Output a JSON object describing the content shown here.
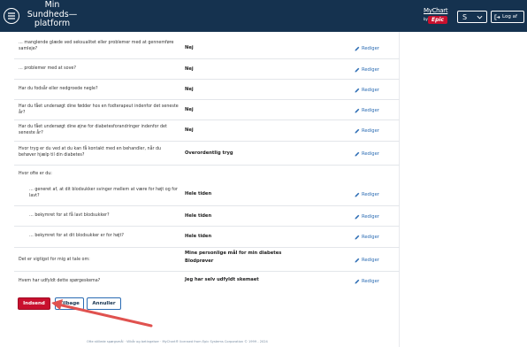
{
  "header": {
    "brand_line1": "Min",
    "brand_line2": "Sundheds—",
    "brand_line3": "platform",
    "mychart_label": "MyChart",
    "mychart_by": "by",
    "epic_label": "Epic",
    "user_initial": "S",
    "logout_label": "Log af"
  },
  "rows": [
    {
      "question": "… manglende glæde ved seksualitet eller problemer med at gennemføre samleje?",
      "answer": "Nej",
      "edit": "Rediger"
    },
    {
      "question": "… problemer med at sove?",
      "answer": "Nej",
      "edit": "Rediger"
    },
    {
      "question": "Har du fodsår eller nedgroede negle?",
      "answer": "Nej",
      "edit": "Rediger"
    },
    {
      "question": "Har du fået undersøgt dine fødder hos en fodterapeut indenfor det seneste år?",
      "answer": "Nej",
      "edit": "Rediger"
    },
    {
      "question": "Har du fået undersøgt dine øjne for diabetesforandringer indenfor det seneste år?",
      "answer": "Nej",
      "edit": "Rediger"
    },
    {
      "question": "Hvor tryg er du ved at du kan få kontakt med en behandler, når du behøver hjælp til din diabetes?",
      "answer": "Overordentlig tryg",
      "edit": "Rediger"
    },
    {
      "question": "Hvor ofte er du:",
      "answer": "",
      "edit": ""
    },
    {
      "question": "… generet af, at dit blodsukker svinger mellem at være for højt og for lavt?",
      "answer": "Hele tiden",
      "edit": "Rediger"
    },
    {
      "question": "… bekymret for at få lavt blodsukker?",
      "answer": "Hele tiden",
      "edit": "Rediger"
    },
    {
      "question": "… bekymret for at dit blodsukker er for højt?",
      "answer": "Hele tiden",
      "edit": "Rediger"
    },
    {
      "question": "Det er vigtigst for mig at tale om:",
      "answer": "Mine personlige mål for min diabetes",
      "answer2": "Blodprøver",
      "edit": "Rediger"
    },
    {
      "question": "Hvem har udfyldt dette spørgeskema?",
      "answer": "Jeg har selv udfyldt skemaet",
      "edit": "Rediger"
    }
  ],
  "buttons": {
    "submit": "Indsend",
    "back": "Tilbage",
    "cancel": "Annuller"
  },
  "footer": {
    "text": "Ofte stillede spørgsmål · Vilkår og betingelser · MyChart® licensed from Epic Systems Corporation © 1999 - 2024"
  },
  "colors": {
    "header_bg": "#15324f",
    "accent_red": "#c8102e",
    "link_blue": "#2a6bb3"
  }
}
